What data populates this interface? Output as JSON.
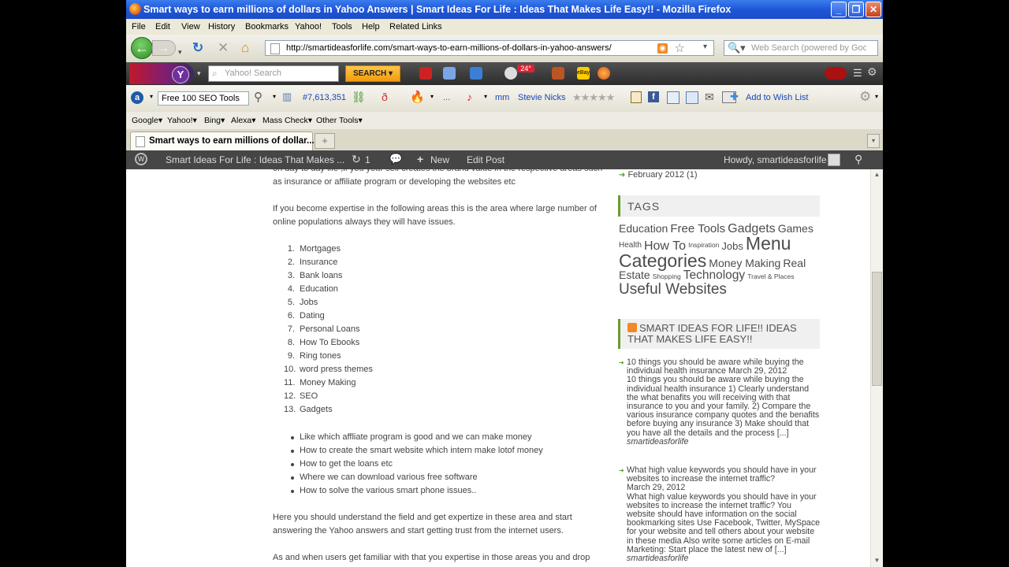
{
  "window": {
    "title": "Smart ways to earn millions of dollars in Yahoo Answers | Smart Ideas For Life : Ideas That Makes Life Easy!! - Mozilla Firefox"
  },
  "menu": [
    "File",
    "Edit",
    "View",
    "History",
    "Bookmarks",
    "Yahoo!",
    "Tools",
    "Help",
    "Related Links"
  ],
  "nav": {
    "url": "http://smartideasforlife.com/smart-ways-to-earn-millions-of-dollars-in-yahoo-answers/",
    "search_placeholder": "Web Search (powered by Google)"
  },
  "yahoo_toolbar": {
    "search_placeholder": "Yahoo! Search",
    "search_button": "SEARCH",
    "weather": "24°"
  },
  "seo_toolbar": {
    "dropdown": "Free 100 SEO Tools",
    "rank": "#7,613,351",
    "ellipsis": "...",
    "mm": "mm",
    "song": "Stevie Nicks",
    "wishlist": "Add to Wish List"
  },
  "bookmarks": [
    "Google",
    "Yahoo!",
    "Bing",
    "Alexa",
    "Mass Check",
    "Other Tools"
  ],
  "tab": {
    "title": "Smart ways to earn millions of dollar...",
    "new_tab": "+"
  },
  "admin_bar": {
    "site": "Smart Ideas For Life : Ideas That Makes ...",
    "updates": "1",
    "new": "New",
    "edit": "Edit Post",
    "howdy": "Howdy, smartideasforlife"
  },
  "post": {
    "p0": "on day to day life ,if you your self creates the brand value in the respective areas such as insurance or affiliate program or developing the websites etc",
    "p1": "If you become expertise in the following areas this is the area where large number of online populations always they will have issues.",
    "ordered": [
      "Mortgages",
      "Insurance",
      "Bank loans",
      "Education",
      "Jobs",
      "Dating",
      "Personal Loans",
      "How To Ebooks",
      "Ring tones",
      "word press themes",
      "Money Making",
      "SEO",
      "Gadgets"
    ],
    "bullets": [
      "Like which affliate program is good and we can make money",
      "How to create the smart website which intern make lotof money",
      "How to get the loans etc",
      "Where we can download various free software",
      "How to solve the various smart phone issues.."
    ],
    "p2": "Here you should understand the field and get expertize in these area and start answering the Yahoo answers and start getting trust from the internet users.",
    "p3": "As and when users get familiar with that you expertise in those areas you and drop"
  },
  "sidebar": {
    "archive": "February 2012 (1)",
    "tags_title": "TAGS",
    "tags": [
      "Education",
      "Free Tools",
      "Gadgets",
      "Games",
      "Health",
      "How To",
      "Inspiration",
      "Jobs",
      "Menu Categories",
      "Money Making",
      "Real Estate",
      "Shopping",
      "Technology",
      "Travel & Places",
      "Useful Websites"
    ],
    "rss_title": "SMART IDEAS FOR LIFE!! IDEAS THAT MAKES LIFE EASY!!",
    "feed": [
      {
        "title": "10 things you should be aware while buying the individual health insurance",
        "date": "March 29, 2012",
        "excerpt": "10 things you should be aware while buying the individual health insurance 1) Clearly understand the what benafits you will receiving with that insurance to you and your family. 2) Compare the various insurance company quotes and the benafits before buying any insurance 3) Make should that you have all  the details and the process [...]",
        "author": "smartideasforlife"
      },
      {
        "title": "What high value keywords you should have in your websites to increase the internet traffic?",
        "date": "March 29, 2012",
        "excerpt": "What high value keywords you should have in your websites to increase the internet traffic? You website should have information on the social bookmarking sites Use Facebook, Twitter, MySpace for your website and tell others about your website in these media Also write some articles on E-mail Marketing: Start place the latest new of [...]",
        "author": "smartideasforlife"
      }
    ]
  }
}
